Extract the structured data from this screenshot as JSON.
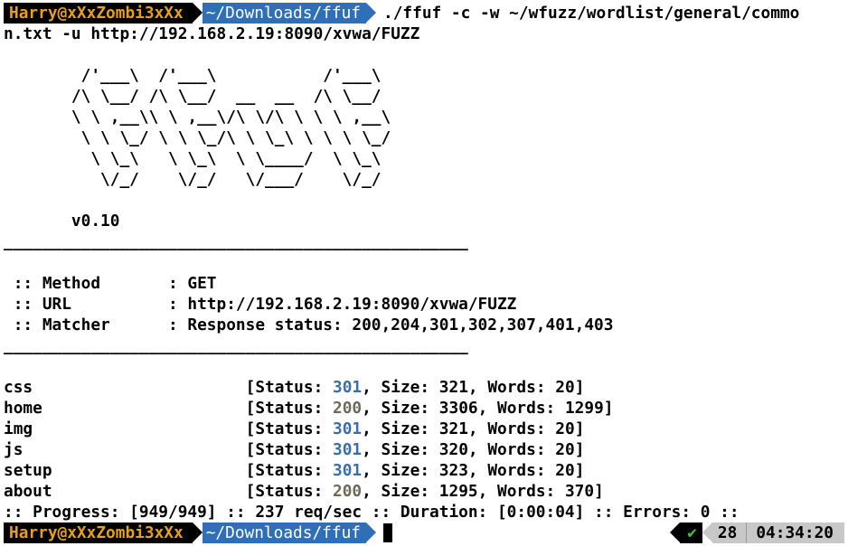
{
  "prompt": {
    "user": "Harry@xXxZombi3xXx",
    "path": "~/Downloads/ffuf",
    "command_line1": "./ffuf -c -w ~/wfuzz/wordlist/general/commo",
    "command_line2": "n.txt -u http://192.168.2.19:8090/xvwa/FUZZ"
  },
  "banner": {
    "lines": [
      "        /'___\\  /'___\\           /'___\\",
      "       /\\ \\__/ /\\ \\__/  __  __  /\\ \\__/",
      "       \\ \\ ,__\\\\ \\ ,__\\/\\ \\/\\ \\ \\ \\ ,__\\",
      "        \\ \\ \\_/ \\ \\ \\_/\\ \\ \\_\\ \\ \\ \\ \\_/",
      "         \\ \\_\\   \\ \\_\\  \\ \\____/  \\ \\_\\",
      "          \\/_/    \\/_/   \\/___/    \\/_/"
    ],
    "version": "       v0.10"
  },
  "separator": "________________________________________________",
  "config": [
    {
      "text": " :: Method       : GET"
    },
    {
      "text": " :: URL          : http://192.168.2.19:8090/xvwa/FUZZ"
    },
    {
      "text": " :: Matcher      : Response status: 200,204,301,302,307,401,403"
    }
  ],
  "results": [
    {
      "name": "css",
      "status": "301",
      "size": "321",
      "words": "20"
    },
    {
      "name": "home",
      "status": "200",
      "size": "3306",
      "words": "1299"
    },
    {
      "name": "img",
      "status": "301",
      "size": "321",
      "words": "20"
    },
    {
      "name": "js",
      "status": "301",
      "size": "320",
      "words": "20"
    },
    {
      "name": "setup",
      "status": "301",
      "size": "323",
      "words": "20"
    },
    {
      "name": "about",
      "status": "200",
      "size": "1295",
      "words": "370"
    }
  ],
  "progress": ":: Progress: [949/949] :: 237 req/sec :: Duration: [0:00:04] :: Errors: 0 ::",
  "right_status": {
    "check": "✔",
    "count": "28",
    "time": "04:34:20"
  },
  "colors": {
    "user_text": "#e8a01c",
    "path_bg": "#2f6fb8",
    "status_301": "#3a6ea8",
    "status_200": "#6e6a58",
    "check": "#3cc83c"
  }
}
